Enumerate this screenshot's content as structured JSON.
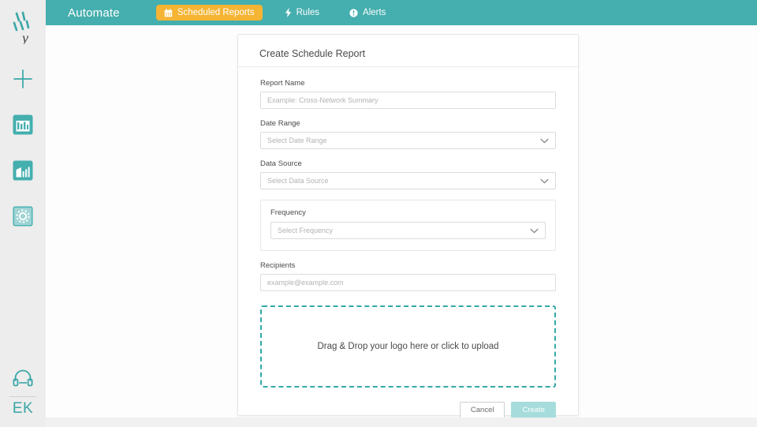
{
  "sidebar": {
    "logo": {
      "icon": "brand-logo-icon",
      "alt": "y"
    },
    "items": [
      {
        "icon": "plus-icon",
        "name": "add"
      },
      {
        "icon": "dashboard-table-icon",
        "name": "dashboard"
      },
      {
        "icon": "bar-chart-icon",
        "name": "analytics"
      },
      {
        "icon": "settings-gear-icon",
        "name": "settings"
      }
    ],
    "support": {
      "icon": "headset-icon"
    },
    "user_initials": "EK"
  },
  "topbar": {
    "brand": "Automate",
    "nav": [
      {
        "label": "Scheduled Reports",
        "icon": "calendar-icon",
        "active": true
      },
      {
        "label": "Rules",
        "icon": "lightning-bolt-icon",
        "active": false
      },
      {
        "label": "Alerts",
        "icon": "alert-info-icon",
        "active": false
      }
    ]
  },
  "card": {
    "title": "Create Schedule Report",
    "fields": {
      "report_name": {
        "label": "Report Name",
        "placeholder": "Example: Cross-Network Summary",
        "value": ""
      },
      "date_range": {
        "label": "Date Range",
        "placeholder": "Select Date Range",
        "value": ""
      },
      "data_source": {
        "label": "Data Source",
        "placeholder": "Select Data Source",
        "value": ""
      },
      "frequency": {
        "label": "Frequency",
        "placeholder": "Select Frequency",
        "value": ""
      },
      "recipients": {
        "label": "Recipients",
        "placeholder": "example@example.com",
        "value": ""
      }
    },
    "dropzone": {
      "text": "Drag & Drop your logo here or click to upload"
    },
    "buttons": {
      "cancel": "Cancel",
      "create": "Create"
    }
  },
  "colors": {
    "teal": "#45aeae",
    "accent_orange": "#f5b433",
    "dropzone_border": "#33a8a8",
    "create_disabled": "#a6dcdc",
    "sidebar_bg": "#ededed"
  }
}
